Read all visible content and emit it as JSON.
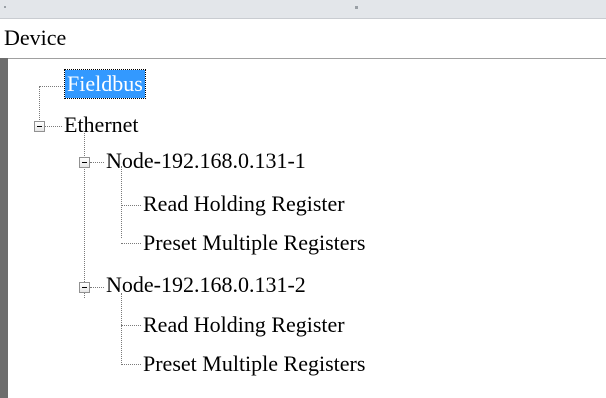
{
  "tree": {
    "header_label": "Device",
    "nodes": [
      {
        "label": "Fieldbus",
        "selected": true
      },
      {
        "label": "Ethernet",
        "expanded": true
      },
      {
        "label": "Node-192.168.0.131-1",
        "expanded": true
      },
      {
        "label": "Read Holding Register"
      },
      {
        "label": "Preset Multiple Registers"
      },
      {
        "label": "Node-192.168.0.131-2",
        "expanded": true
      },
      {
        "label": "Read Holding Register"
      },
      {
        "label": "Preset Multiple Registers"
      }
    ]
  },
  "colors": {
    "selection_bg": "#3399ff",
    "selection_text": "#ffffff",
    "top_strip": "#e3e6ea"
  },
  "icons": {
    "expanded_toggle": "minus-box-icon"
  }
}
